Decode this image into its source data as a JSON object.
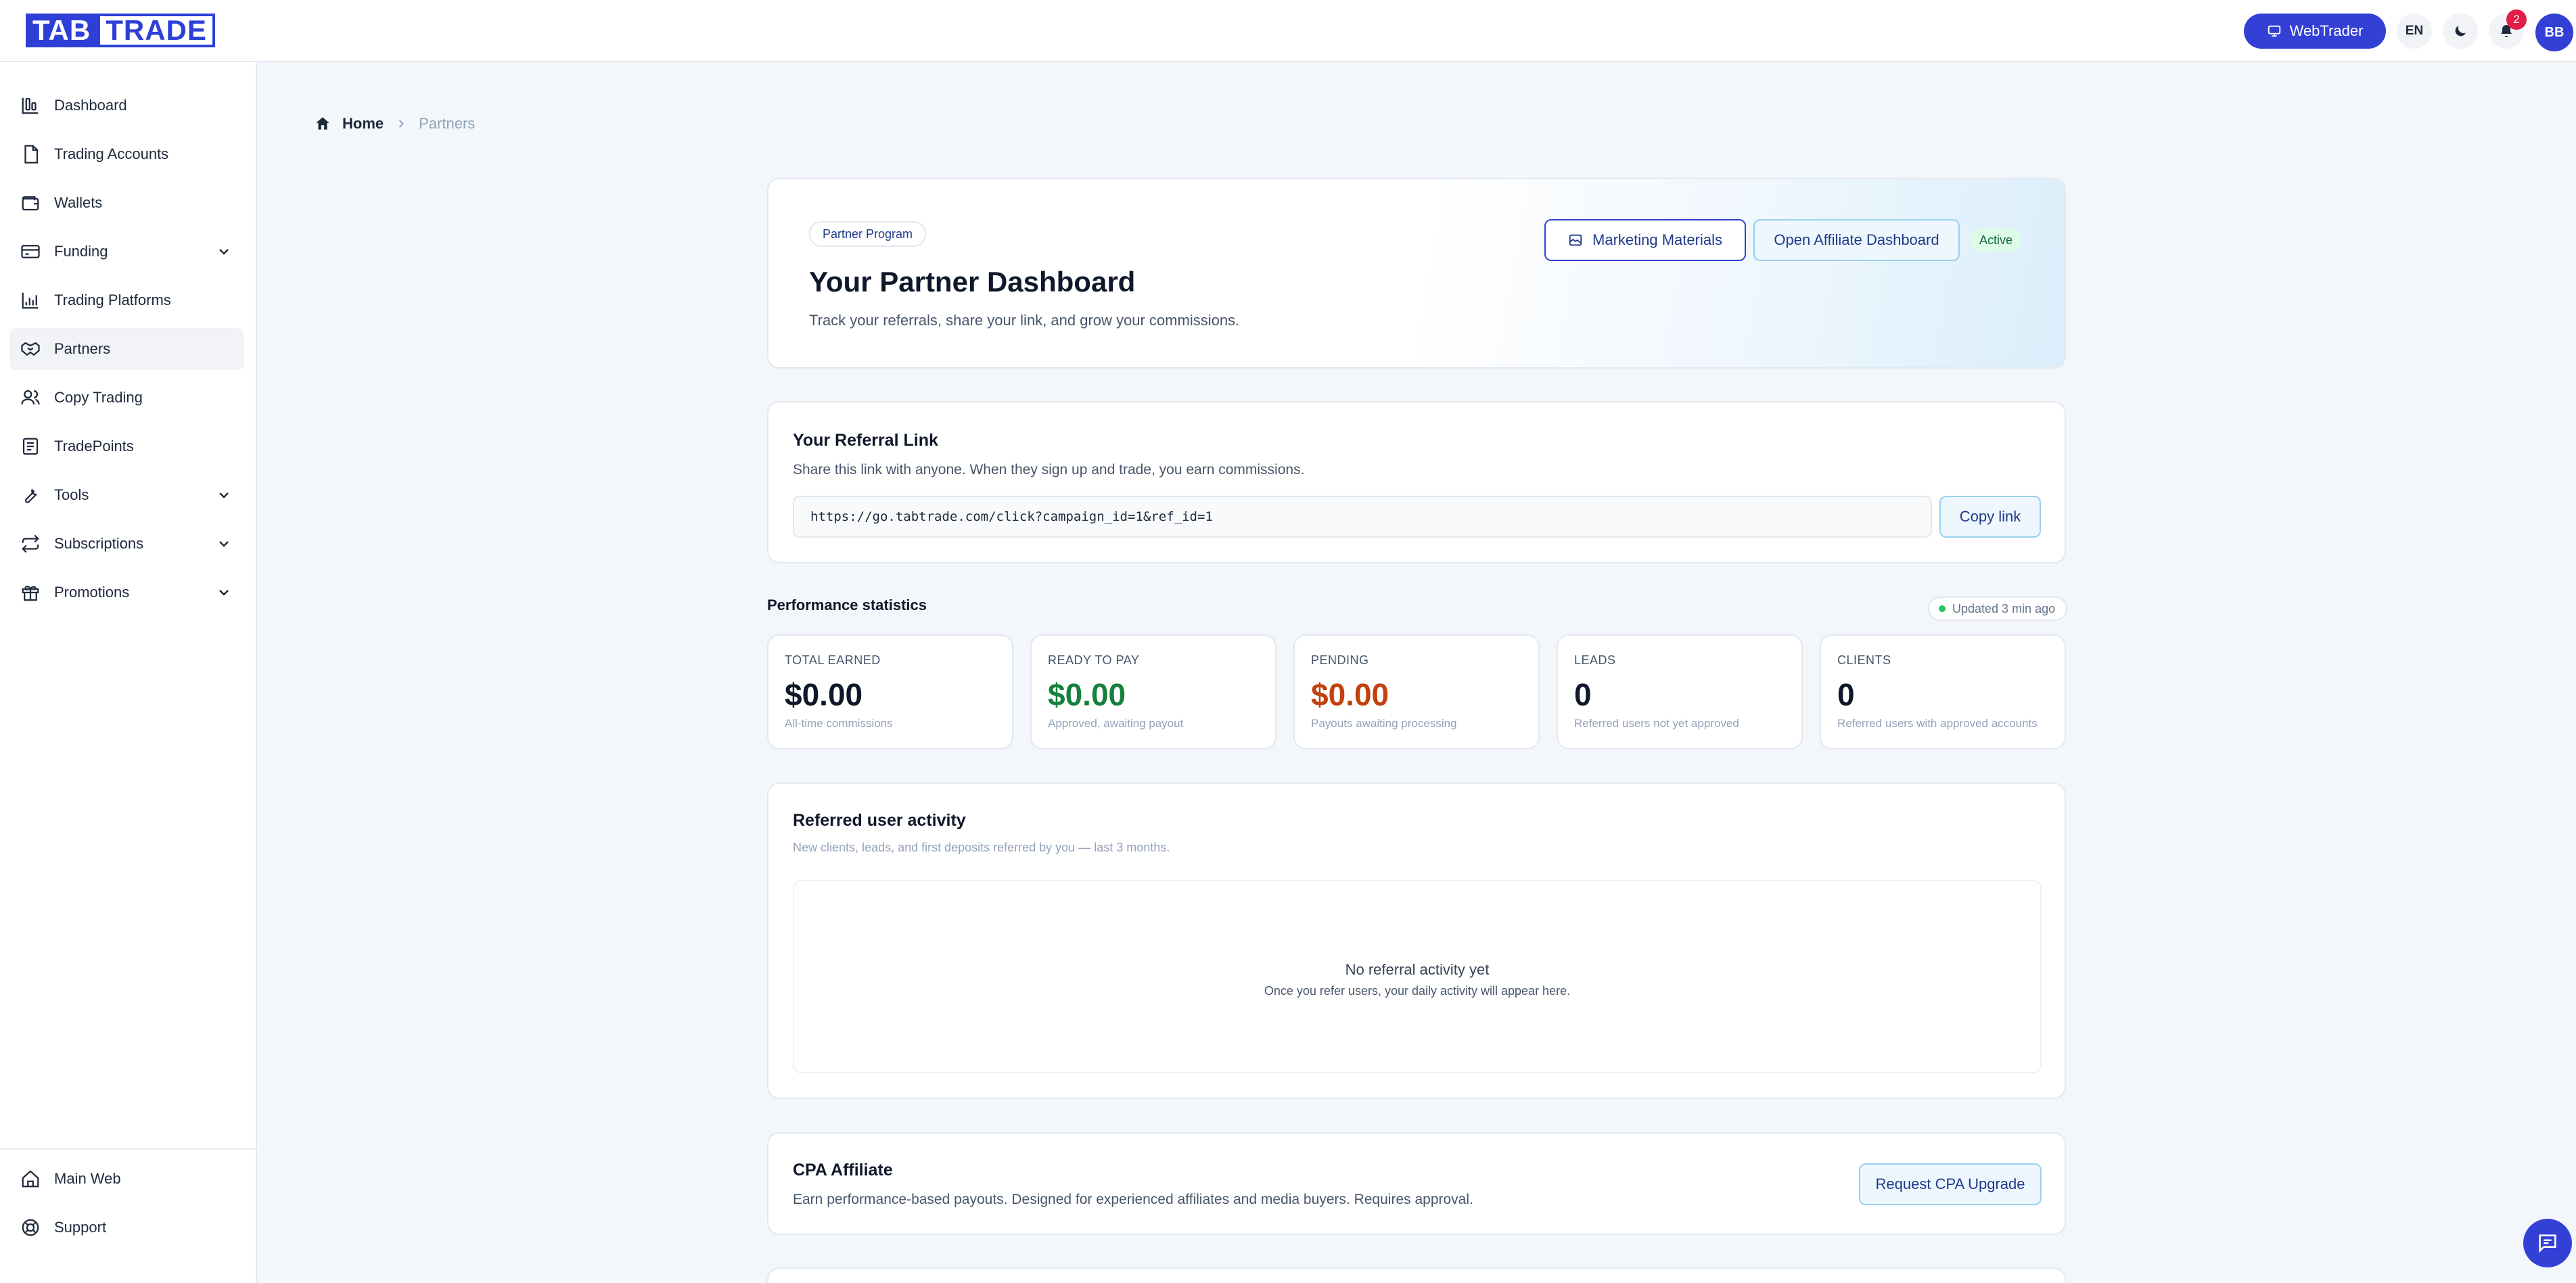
{
  "header": {
    "logo_left": "TAB",
    "logo_right": "TRADE",
    "webtrader_label": "WebTrader",
    "language": "EN",
    "notification_count": "2",
    "avatar_initials": "BB",
    "accent_color": "#3340d6"
  },
  "sidebar": {
    "items": [
      {
        "label": "Dashboard",
        "icon": "dashboard-icon"
      },
      {
        "label": "Trading Accounts",
        "icon": "document-icon"
      },
      {
        "label": "Wallets",
        "icon": "wallet-icon"
      },
      {
        "label": "Funding",
        "icon": "card-icon",
        "expandable": true
      },
      {
        "label": "Trading Platforms",
        "icon": "chart-icon"
      },
      {
        "label": "Partners",
        "icon": "handshake-icon",
        "active": true
      },
      {
        "label": "Copy Trading",
        "icon": "users-icon"
      },
      {
        "label": "TradePoints",
        "icon": "list-icon"
      },
      {
        "label": "Tools",
        "icon": "wrench-icon",
        "expandable": true
      },
      {
        "label": "Subscriptions",
        "icon": "repeat-icon",
        "expandable": true
      },
      {
        "label": "Promotions",
        "icon": "gift-icon",
        "expandable": true
      }
    ],
    "bottom_items": [
      {
        "label": "Main Web",
        "icon": "home-icon"
      },
      {
        "label": "Support",
        "icon": "lifebuoy-icon"
      }
    ]
  },
  "breadcrumb": {
    "home": "Home",
    "current": "Partners"
  },
  "hero": {
    "badge": "Partner Program",
    "title": "Your Partner Dashboard",
    "subtitle": "Track your referrals, share your link, and grow your commissions.",
    "marketing_label": "Marketing Materials",
    "affiliate_label": "Open Affiliate Dashboard",
    "status": "Active"
  },
  "referral": {
    "title": "Your Referral Link",
    "description": "Share this link with anyone. When they sign up and trade, you earn commissions.",
    "link": "https://go.tabtrade.com/click?campaign_id=1&ref_id=1",
    "copy_label": "Copy link"
  },
  "performance": {
    "title": "Performance statistics",
    "updated": "Updated 3 min ago",
    "stats": [
      {
        "label": "TOTAL EARNED",
        "value": "$0.00",
        "desc": "All-time commissions",
        "color": "#0f172a"
      },
      {
        "label": "READY TO PAY",
        "value": "$0.00",
        "desc": "Approved, awaiting payout",
        "color": "#15803d"
      },
      {
        "label": "PENDING",
        "value": "$0.00",
        "desc": "Payouts awaiting processing",
        "color": "#c2410c"
      },
      {
        "label": "LEADS",
        "value": "0",
        "desc": "Referred users not yet approved",
        "color": "#0f172a"
      },
      {
        "label": "CLIENTS",
        "value": "0",
        "desc": "Referred users with approved accounts",
        "color": "#0f172a"
      }
    ]
  },
  "activity": {
    "title": "Referred user activity",
    "subtitle": "New clients, leads, and first deposits referred by you — last 3 months.",
    "empty_title": "No referral activity yet",
    "empty_subtitle": "Once you refer users, your daily activity will appear here."
  },
  "cpa": {
    "title": "CPA Affiliate",
    "description": "Earn performance-based payouts. Designed for experienced affiliates and media buyers. Requires approval.",
    "button_label": "Request CPA Upgrade"
  }
}
